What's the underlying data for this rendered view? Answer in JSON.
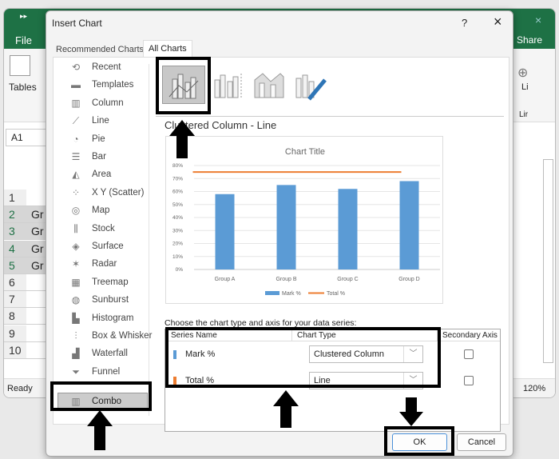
{
  "excel": {
    "file_tab": "File",
    "share": "Share",
    "tables_label": "Tables",
    "links_label": "Li",
    "links_group": "Lir",
    "name_box": "A1",
    "rows": [
      "1",
      "2",
      "3",
      "4",
      "5",
      "6",
      "7",
      "8",
      "9",
      "10"
    ],
    "cells": [
      "",
      "Gr",
      "Gr",
      "Gr",
      "Gr"
    ],
    "status": "Ready",
    "zoom": "120%"
  },
  "dialog": {
    "title": "Insert Chart",
    "help": "?",
    "close": "×",
    "tabs": [
      {
        "label": "Recommended Charts"
      },
      {
        "label": "All Charts"
      }
    ],
    "chart_types": [
      {
        "label": "Recent",
        "icon": "⟲"
      },
      {
        "label": "Templates",
        "icon": "▬"
      },
      {
        "label": "Column",
        "icon": "▥"
      },
      {
        "label": "Line",
        "icon": "⟋"
      },
      {
        "label": "Pie",
        "icon": "◔"
      },
      {
        "label": "Bar",
        "icon": "☰"
      },
      {
        "label": "Area",
        "icon": "◭"
      },
      {
        "label": "X Y (Scatter)",
        "icon": "⁘"
      },
      {
        "label": "Map",
        "icon": "◎"
      },
      {
        "label": "Stock",
        "icon": "⫼"
      },
      {
        "label": "Surface",
        "icon": "◈"
      },
      {
        "label": "Radar",
        "icon": "✶"
      },
      {
        "label": "Treemap",
        "icon": "▦"
      },
      {
        "label": "Sunburst",
        "icon": "◍"
      },
      {
        "label": "Histogram",
        "icon": "▙"
      },
      {
        "label": "Box & Whisker",
        "icon": "⫶"
      },
      {
        "label": "Waterfall",
        "icon": "▟"
      },
      {
        "label": "Funnel",
        "icon": "⏷"
      },
      {
        "label": "Combo",
        "icon": "▥"
      }
    ],
    "subtype_title": "Clustered Column - Line",
    "series_prompt": "Choose the chart type and axis for your data series:",
    "table_headers": [
      "Series Name",
      "Chart Type",
      "Secondary Axis"
    ],
    "series": [
      {
        "name": "Mark %",
        "color": "#5b9bd5",
        "type": "Clustered Column",
        "secondary": false
      },
      {
        "name": "Total %",
        "color": "#ed7d31",
        "type": "Line",
        "secondary": false
      }
    ],
    "ok": "OK",
    "cancel": "Cancel"
  },
  "chart_data": {
    "type": "bar",
    "title": "Chart Title",
    "categories": [
      "Group A",
      "Group B",
      "Group C",
      "Group D"
    ],
    "series": [
      {
        "name": "Mark %",
        "type": "bar",
        "color": "#5b9bd5",
        "values": [
          58,
          65,
          62,
          68
        ]
      },
      {
        "name": "Total %",
        "type": "line",
        "color": "#ed7d31",
        "values": [
          75,
          75,
          75,
          75
        ]
      }
    ],
    "yticks": [
      "0%",
      "10%",
      "20%",
      "30%",
      "40%",
      "50%",
      "60%",
      "70%",
      "80%"
    ],
    "ylim": [
      0,
      80
    ],
    "legend": "bottom",
    "grid": true
  }
}
